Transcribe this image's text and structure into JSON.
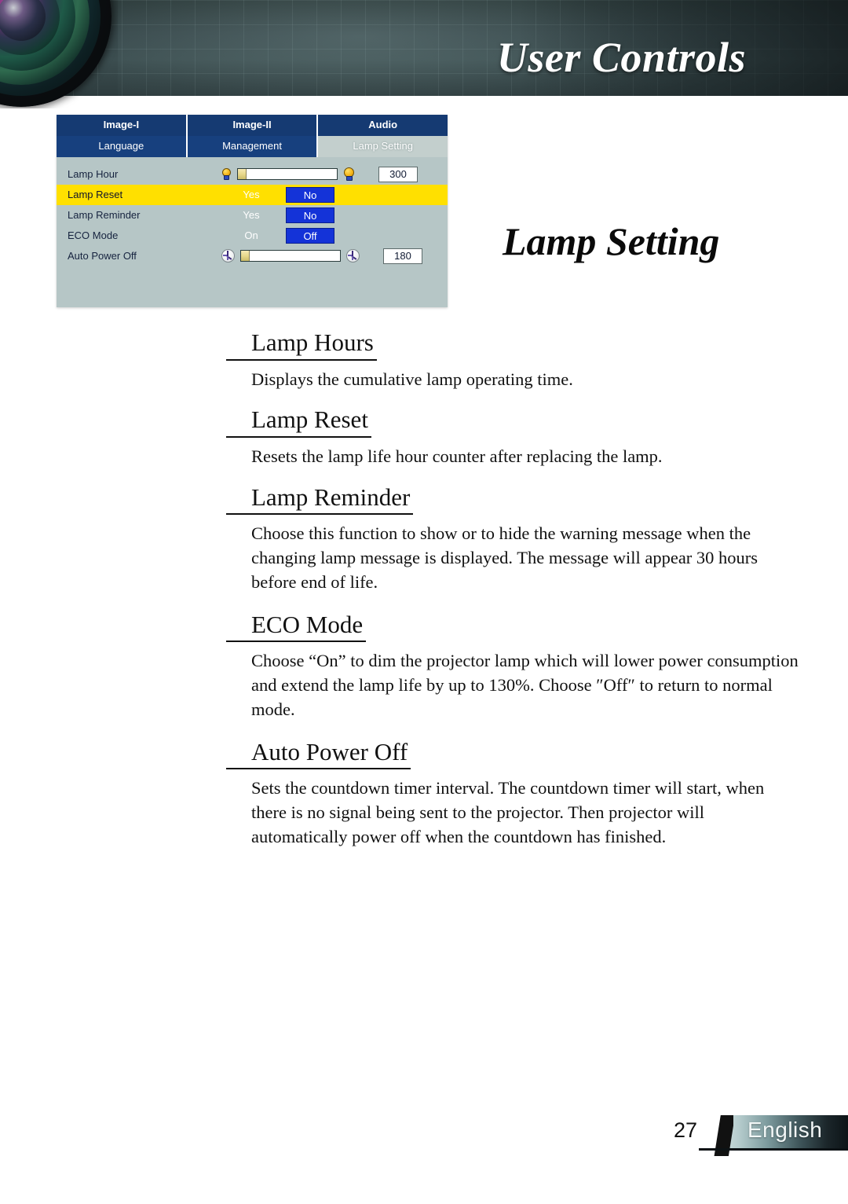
{
  "header": {
    "title": "User Controls",
    "lens_icon": "camera-lens-graphic"
  },
  "page_title": "Lamp Setting",
  "osd": {
    "tabs_row1": [
      {
        "label": "Image-I",
        "active": false
      },
      {
        "label": "Image-II",
        "active": false
      },
      {
        "label": "Audio",
        "active": false
      }
    ],
    "tabs_row2": [
      {
        "label": "Language",
        "active": false
      },
      {
        "label": "Management",
        "active": false
      },
      {
        "label": "Lamp Setting",
        "active": true
      }
    ],
    "rows": [
      {
        "label": "Lamp Hour",
        "type": "slider",
        "value": "300",
        "left_icon": "lamp-bulb-small-icon",
        "right_icon": "lamp-bulb-large-icon",
        "highlighted": false
      },
      {
        "label": "Lamp Reset",
        "type": "toggle",
        "option_a": "Yes",
        "option_b": "No",
        "selected": "No",
        "highlighted": true
      },
      {
        "label": "Lamp Reminder",
        "type": "toggle",
        "option_a": "Yes",
        "option_b": "No",
        "selected": "No",
        "highlighted": false
      },
      {
        "label": "ECO Mode",
        "type": "toggle",
        "option_a": "On",
        "option_b": "Off",
        "selected": "Off",
        "highlighted": false
      },
      {
        "label": "Auto Power Off",
        "type": "slider",
        "value": "180",
        "left_icon": "timer-small-icon",
        "right_icon": "timer-large-icon",
        "highlighted": false
      }
    ],
    "colors": {
      "tab_inactive": "#153a72",
      "tab_active": "#c3cfcd",
      "panel_bg": "#b6c6c6",
      "highlight_row": "#ffe000",
      "selected_button": "#1433d8"
    }
  },
  "sections": [
    {
      "heading": "Lamp Hours",
      "body": "Displays the cumulative lamp operating time."
    },
    {
      "heading": "Lamp Reset ",
      "body": "Resets the lamp life hour counter after replacing the lamp."
    },
    {
      "heading": "Lamp Reminder",
      "body": "Choose this function to show or to hide the warning message when the changing lamp message is displayed. The message will appear 30 hours before end of life."
    },
    {
      "heading": "ECO Mode",
      "body": "Choose “On” to dim the projector lamp which will lower power consumption and extend the lamp life by up to 130%. Choose ″Off″ to return to normal mode."
    },
    {
      "heading": "Auto Power Off",
      "body": "Sets the countdown timer interval. The countdown timer will start, when there is no signal being sent to the projector. Then projector will automatically power off when the countdown has finished."
    }
  ],
  "footer": {
    "page_number": "27",
    "language": "English"
  }
}
